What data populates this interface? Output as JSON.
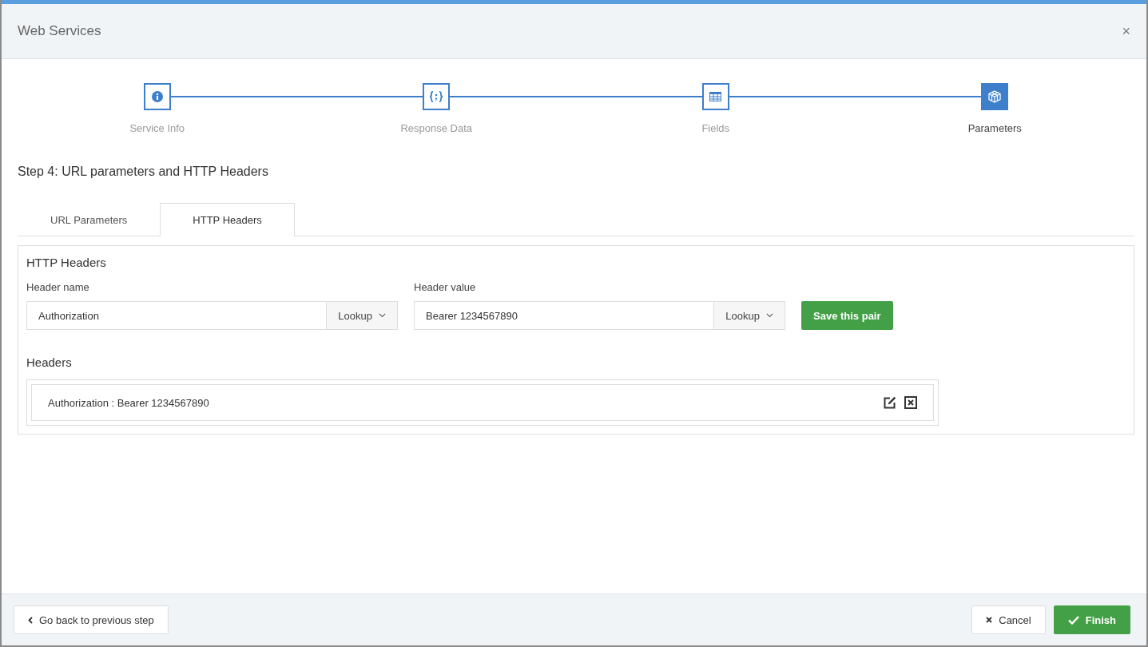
{
  "window": {
    "title": "Web Services",
    "close": "×"
  },
  "steps": [
    {
      "label": "Service Info",
      "kind": "info",
      "selected": false
    },
    {
      "label": "Response Data",
      "kind": "code",
      "selected": false
    },
    {
      "label": "Fields",
      "kind": "table",
      "selected": false
    },
    {
      "label": "Parameters",
      "kind": "cube",
      "selected": true
    }
  ],
  "step_title": "Step 4: URL parameters and HTTP Headers",
  "tabs": [
    {
      "label": "URL Parameters",
      "selected": false
    },
    {
      "label": "HTTP Headers",
      "selected": true
    }
  ],
  "panel": {
    "title": "HTTP Headers",
    "fields": [
      {
        "label": "Header name",
        "value": "Authorization",
        "lookup": "Lookup"
      },
      {
        "label": "Header value",
        "value": "Bearer 1234567890",
        "lookup": "Lookup"
      }
    ],
    "save_button": "Save this pair",
    "list_title": "Headers",
    "headers": [
      {
        "text": "Authorization : Bearer 1234567890"
      }
    ]
  },
  "footer": {
    "back": "Go back to previous step",
    "cancel": "Cancel",
    "finish": "Finish"
  }
}
